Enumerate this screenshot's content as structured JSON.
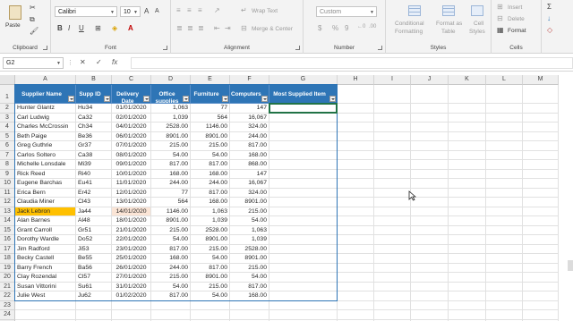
{
  "ribbon": {
    "clipboard": {
      "label": "Clipboard",
      "paste": "Paste"
    },
    "font": {
      "label": "Font",
      "name": "Calibri",
      "size": "10",
      "bold": "B",
      "italic": "I",
      "underline": "U"
    },
    "alignment": {
      "label": "Alignment",
      "wrap": "Wrap Text",
      "merge": "Merge & Center"
    },
    "number": {
      "label": "Number",
      "format": "Custom",
      "currency": "$",
      "percent": "%",
      "comma": "9"
    },
    "styles": {
      "label": "Styles",
      "conditional": "Conditional",
      "conditional2": "Formatting",
      "format_as": "Format as",
      "format_as2": "Table",
      "cell": "Cell",
      "cell2": "Styles"
    },
    "cells": {
      "label": "Cells",
      "insert": "Insert",
      "delete": "Delete",
      "format": "Format"
    }
  },
  "formula_bar": {
    "name_box": "G2",
    "cancel": "✕",
    "enter": "✓",
    "fx": "fx",
    "content": ""
  },
  "columns": [
    "A",
    "B",
    "C",
    "D",
    "E",
    "F",
    "G",
    "H",
    "I",
    "J",
    "K",
    "L",
    "M"
  ],
  "headers": [
    "Supplier Name",
    "Supp ID",
    "Delivery Date",
    "Office supplies",
    "Furniture",
    "Computers",
    "Most Supplied Item"
  ],
  "rows": [
    [
      "Hunter Glantz",
      "Hu34",
      "01/01/2020",
      "1,063",
      "77",
      "147",
      ""
    ],
    [
      "Carl Ludwig",
      "Ca32",
      "02/01/2020",
      "1,039",
      "564",
      "16,067",
      ""
    ],
    [
      "Charles McCrossin",
      "Ch34",
      "04/01/2020",
      "2528.00",
      "1146.00",
      "324.00",
      ""
    ],
    [
      "Beth Paige",
      "Be36",
      "06/01/2020",
      "8901.00",
      "8901.00",
      "244.00",
      ""
    ],
    [
      "Greg Guthrie",
      "Gr37",
      "07/01/2020",
      "215.00",
      "215.00",
      "817.00",
      ""
    ],
    [
      "Carlos Soltero",
      "Ca38",
      "08/01/2020",
      "54.00",
      "54.00",
      "168.00",
      ""
    ],
    [
      "Michelle Lonsdale",
      "Mi39",
      "09/01/2020",
      "817.00",
      "817.00",
      "868.00",
      ""
    ],
    [
      "Rick Reed",
      "Ri40",
      "10/01/2020",
      "168.00",
      "168.00",
      "147",
      ""
    ],
    [
      "Eugene Barchas",
      "Eu41",
      "11/01/2020",
      "244.00",
      "244.00",
      "16,067",
      ""
    ],
    [
      "Erica Bern",
      "Er42",
      "12/01/2020",
      "77",
      "817.00",
      "324.00",
      ""
    ],
    [
      "Claudia Miner",
      "Cl43",
      "13/01/2020",
      "564",
      "168.00",
      "8901.00",
      ""
    ],
    [
      "Jack Lebron",
      "Ja44",
      "14/01/2020",
      "1146.00",
      "1,063",
      "215.00",
      ""
    ],
    [
      "Alan Barnes",
      "Al48",
      "18/01/2020",
      "8901.00",
      "1,039",
      "54.00",
      ""
    ],
    [
      "Grant Carroll",
      "Gr51",
      "21/01/2020",
      "215.00",
      "2528.00",
      "1,063",
      ""
    ],
    [
      "Dorothy Wardle",
      "Do52",
      "22/01/2020",
      "54.00",
      "8901.00",
      "1,039",
      ""
    ],
    [
      "Jim Radford",
      "Ji53",
      "23/01/2020",
      "817.00",
      "215.00",
      "2528.00",
      ""
    ],
    [
      "Becky Castell",
      "Be55",
      "25/01/2020",
      "168.00",
      "54.00",
      "8901.00",
      ""
    ],
    [
      "Barry French",
      "Ba56",
      "26/01/2020",
      "244.00",
      "817.00",
      "215.00",
      ""
    ],
    [
      "Clay Rozendal",
      "Cl57",
      "27/01/2020",
      "215.00",
      "8901.00",
      "54.00",
      ""
    ],
    [
      "Susan Vittorini",
      "Su61",
      "31/01/2020",
      "54.00",
      "215.00",
      "817.00",
      ""
    ],
    [
      "Julie West",
      "Ju62",
      "01/02/2020",
      "817.00",
      "54.00",
      "168.00",
      ""
    ]
  ],
  "colors": {
    "header_fill": "#2e75b6",
    "selected_name": "#ffc000",
    "selected_date": "#fbe5d6",
    "active_cell_border": "#217346"
  }
}
